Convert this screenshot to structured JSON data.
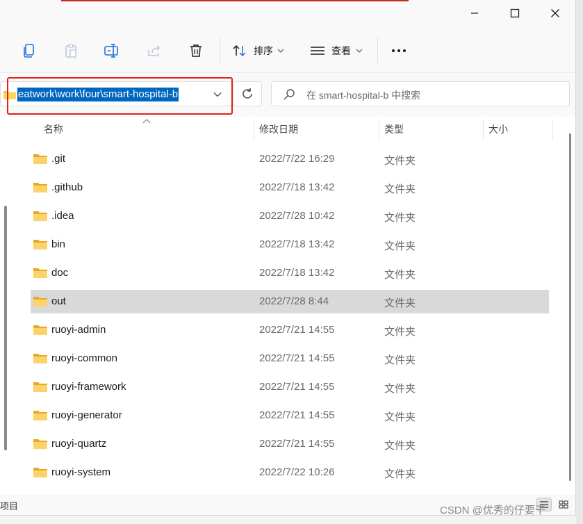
{
  "window": {
    "minimize_glyph": "—",
    "maximize_glyph": "□",
    "close_glyph": "✕"
  },
  "toolbar": {
    "sort_label": "排序",
    "view_label": "查看",
    "more_glyph": "•••"
  },
  "address": {
    "path": "eatwork\\work\\four\\smart-hospital-b"
  },
  "search": {
    "placeholder": "在 smart-hospital-b 中搜索"
  },
  "columns": {
    "name": "名称",
    "date": "修改日期",
    "type": "类型",
    "size": "大小"
  },
  "files": [
    {
      "name": ".git",
      "date": "2022/7/22 16:29",
      "type": "文件夹"
    },
    {
      "name": ".github",
      "date": "2022/7/18 13:42",
      "type": "文件夹"
    },
    {
      "name": ".idea",
      "date": "2022/7/28 10:42",
      "type": "文件夹"
    },
    {
      "name": "bin",
      "date": "2022/7/18 13:42",
      "type": "文件夹"
    },
    {
      "name": "doc",
      "date": "2022/7/18 13:42",
      "type": "文件夹"
    },
    {
      "name": "out",
      "date": "2022/7/28 8:44",
      "type": "文件夹",
      "selected": true
    },
    {
      "name": "ruoyi-admin",
      "date": "2022/7/21 14:55",
      "type": "文件夹"
    },
    {
      "name": "ruoyi-common",
      "date": "2022/7/21 14:55",
      "type": "文件夹"
    },
    {
      "name": "ruoyi-framework",
      "date": "2022/7/21 14:55",
      "type": "文件夹"
    },
    {
      "name": "ruoyi-generator",
      "date": "2022/7/21 14:55",
      "type": "文件夹"
    },
    {
      "name": "ruoyi-quartz",
      "date": "2022/7/21 14:55",
      "type": "文件夹"
    },
    {
      "name": "ruoyi-system",
      "date": "2022/7/22 10:26",
      "type": "文件夹"
    }
  ],
  "status": {
    "text": "项目"
  },
  "watermark": "CSDN @优秀的仔要干",
  "colors": {
    "selection": "#0067c0",
    "highlight_box": "#e0201a",
    "folder": "#f5c443",
    "selected_row": "#d9d9d9"
  }
}
